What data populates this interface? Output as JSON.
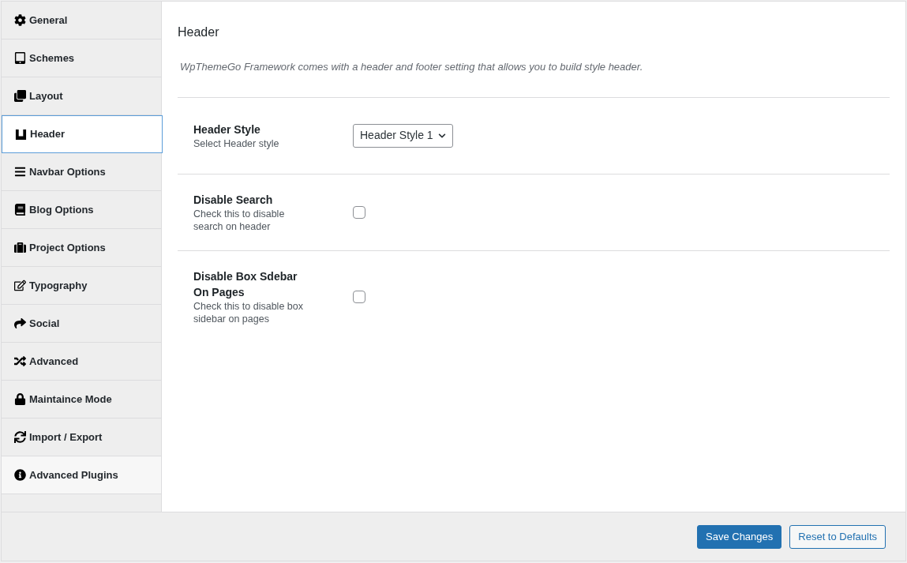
{
  "sidebar": {
    "items": [
      {
        "label": "General",
        "selected": false,
        "hovered": false
      },
      {
        "label": "Schemes",
        "selected": false,
        "hovered": false
      },
      {
        "label": "Layout",
        "selected": false,
        "hovered": false
      },
      {
        "label": "Header",
        "selected": true,
        "hovered": false
      },
      {
        "label": "Navbar Options",
        "selected": false,
        "hovered": false
      },
      {
        "label": "Blog Options",
        "selected": false,
        "hovered": false
      },
      {
        "label": "Project Options",
        "selected": false,
        "hovered": false
      },
      {
        "label": "Typography",
        "selected": false,
        "hovered": false
      },
      {
        "label": "Social",
        "selected": false,
        "hovered": false
      },
      {
        "label": "Advanced",
        "selected": false,
        "hovered": false
      },
      {
        "label": "Maintaince Mode",
        "selected": false,
        "hovered": false
      },
      {
        "label": "Import / Export",
        "selected": false,
        "hovered": false
      },
      {
        "label": "Advanced Plugins",
        "selected": false,
        "hovered": true
      }
    ]
  },
  "section": {
    "title": "Header",
    "description": "WpThemeGo Framework comes with a header and footer setting that allows you to build style header.",
    "fields": [
      {
        "kind": "select",
        "label": "Header Style",
        "hint": "Select Header style",
        "value": "Header Style 1"
      },
      {
        "kind": "checkbox",
        "label": "Disable Search",
        "hint": "Check this to disable search on header",
        "checked": false
      },
      {
        "kind": "checkbox",
        "label": "Disable Box Sdebar On Pages",
        "hint": "Check this to disable box sidebar on pages",
        "checked": false
      }
    ]
  },
  "footer": {
    "buttons": [
      {
        "label": "Save Changes",
        "kind": "primary"
      },
      {
        "label": "Reset to Defaults",
        "kind": "secondary"
      }
    ]
  }
}
